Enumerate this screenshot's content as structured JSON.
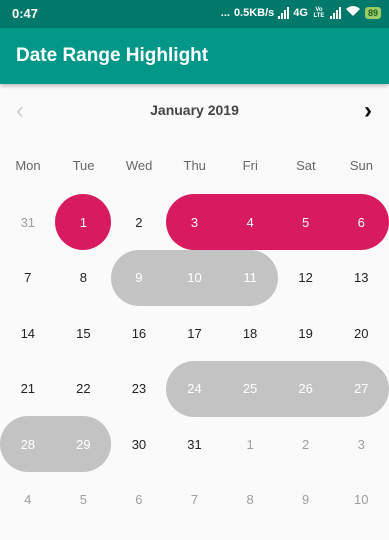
{
  "status_bar": {
    "time": "0:47",
    "dots": "...",
    "network_speed": "0.5KB/s",
    "network_type": "4G",
    "volte": "Vo LTE",
    "battery": "89"
  },
  "toolbar": {
    "title": "Date Range Highlight"
  },
  "calendar": {
    "month_label": "January 2019",
    "prev_icon": "‹",
    "next_icon": "›",
    "weekdays": [
      "Mon",
      "Tue",
      "Wed",
      "Thu",
      "Fri",
      "Sat",
      "Sun"
    ],
    "weeks": [
      [
        {
          "d": "31",
          "t": "out"
        },
        {
          "d": "1",
          "t": "sel"
        },
        {
          "d": "2",
          "t": "in"
        },
        {
          "d": "3",
          "t": "sel"
        },
        {
          "d": "4",
          "t": "sel"
        },
        {
          "d": "5",
          "t": "sel"
        },
        {
          "d": "6",
          "t": "sel"
        }
      ],
      [
        {
          "d": "7",
          "t": "in"
        },
        {
          "d": "8",
          "t": "in"
        },
        {
          "d": "9",
          "t": "sel"
        },
        {
          "d": "10",
          "t": "sel"
        },
        {
          "d": "11",
          "t": "sel"
        },
        {
          "d": "12",
          "t": "in"
        },
        {
          "d": "13",
          "t": "in"
        }
      ],
      [
        {
          "d": "14",
          "t": "in"
        },
        {
          "d": "15",
          "t": "in"
        },
        {
          "d": "16",
          "t": "in"
        },
        {
          "d": "17",
          "t": "in"
        },
        {
          "d": "18",
          "t": "in"
        },
        {
          "d": "19",
          "t": "in"
        },
        {
          "d": "20",
          "t": "in"
        }
      ],
      [
        {
          "d": "21",
          "t": "in"
        },
        {
          "d": "22",
          "t": "in"
        },
        {
          "d": "23",
          "t": "in"
        },
        {
          "d": "24",
          "t": "sel"
        },
        {
          "d": "25",
          "t": "sel"
        },
        {
          "d": "26",
          "t": "sel"
        },
        {
          "d": "27",
          "t": "sel"
        }
      ],
      [
        {
          "d": "28",
          "t": "sel"
        },
        {
          "d": "29",
          "t": "sel"
        },
        {
          "d": "30",
          "t": "in"
        },
        {
          "d": "31",
          "t": "in"
        },
        {
          "d": "1",
          "t": "out"
        },
        {
          "d": "2",
          "t": "out"
        },
        {
          "d": "3",
          "t": "out"
        }
      ],
      [
        {
          "d": "4",
          "t": "out"
        },
        {
          "d": "5",
          "t": "out"
        },
        {
          "d": "6",
          "t": "out"
        },
        {
          "d": "7",
          "t": "out"
        },
        {
          "d": "8",
          "t": "out"
        },
        {
          "d": "9",
          "t": "out"
        },
        {
          "d": "10",
          "t": "out"
        }
      ]
    ],
    "highlights": [
      {
        "week": 0,
        "from": 1,
        "to": 1,
        "color": "pink"
      },
      {
        "week": 0,
        "from": 3,
        "to": 6,
        "color": "pink"
      },
      {
        "week": 1,
        "from": 2,
        "to": 4,
        "color": "grey"
      },
      {
        "week": 3,
        "from": 3,
        "to": 6,
        "color": "grey"
      },
      {
        "week": 4,
        "from": 0,
        "to": 1,
        "color": "grey"
      }
    ],
    "colors": {
      "pink": "#d81b60",
      "grey": "#c3c3c3",
      "toolbar": "#009688",
      "status_bar": "#00796b"
    }
  }
}
